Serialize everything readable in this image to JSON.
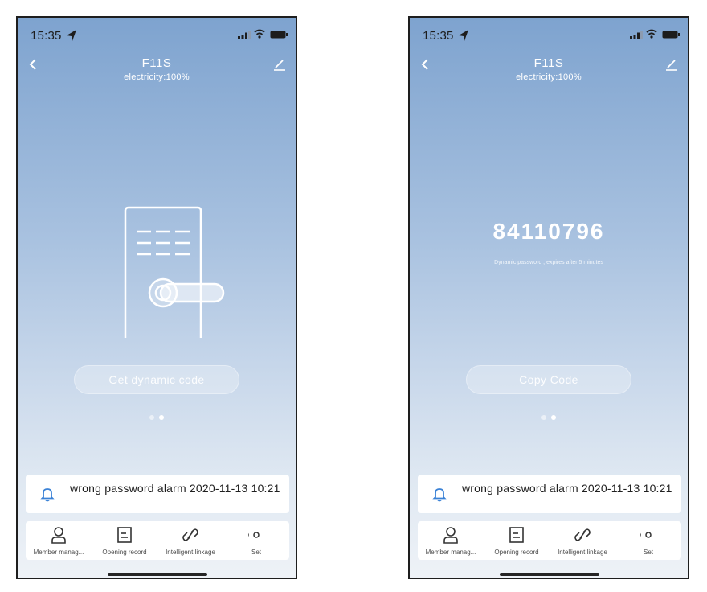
{
  "screens": [
    {
      "status_bar": {
        "time": "15:35"
      },
      "header": {
        "title": "F11S",
        "subtitle": "electricity:100%"
      },
      "main": {
        "button_label": "Get dynamic code"
      },
      "pager": {
        "count": 2,
        "active_index": 1
      },
      "alarm": {
        "text": "wrong password alarm 2020-11-13 10:21"
      },
      "bottom_nav": {
        "items": [
          {
            "label": "Member manag...",
            "icon": "person-icon"
          },
          {
            "label": "Opening record",
            "icon": "document-icon"
          },
          {
            "label": "Intelligent linkage",
            "icon": "link-icon"
          },
          {
            "label": "Set",
            "icon": "more-dots-icon"
          }
        ]
      }
    },
    {
      "status_bar": {
        "time": "15:35"
      },
      "header": {
        "title": "F11S",
        "subtitle": "electricity:100%"
      },
      "main": {
        "code": "84110796",
        "code_note": "Dynamic password , expires after 5 minutes",
        "button_label": "Copy Code"
      },
      "pager": {
        "count": 2,
        "active_index": 1
      },
      "alarm": {
        "text": "wrong password alarm 2020-11-13 10:21"
      },
      "bottom_nav": {
        "items": [
          {
            "label": "Member manag...",
            "icon": "person-icon"
          },
          {
            "label": "Opening record",
            "icon": "document-icon"
          },
          {
            "label": "Intelligent linkage",
            "icon": "link-icon"
          },
          {
            "label": "Set",
            "icon": "more-dots-icon"
          }
        ]
      }
    }
  ],
  "colors": {
    "background_top": "#7ea3cf",
    "background_bottom": "#eef2f7",
    "accent_blue": "#3b82d6",
    "card": "#ffffff"
  }
}
